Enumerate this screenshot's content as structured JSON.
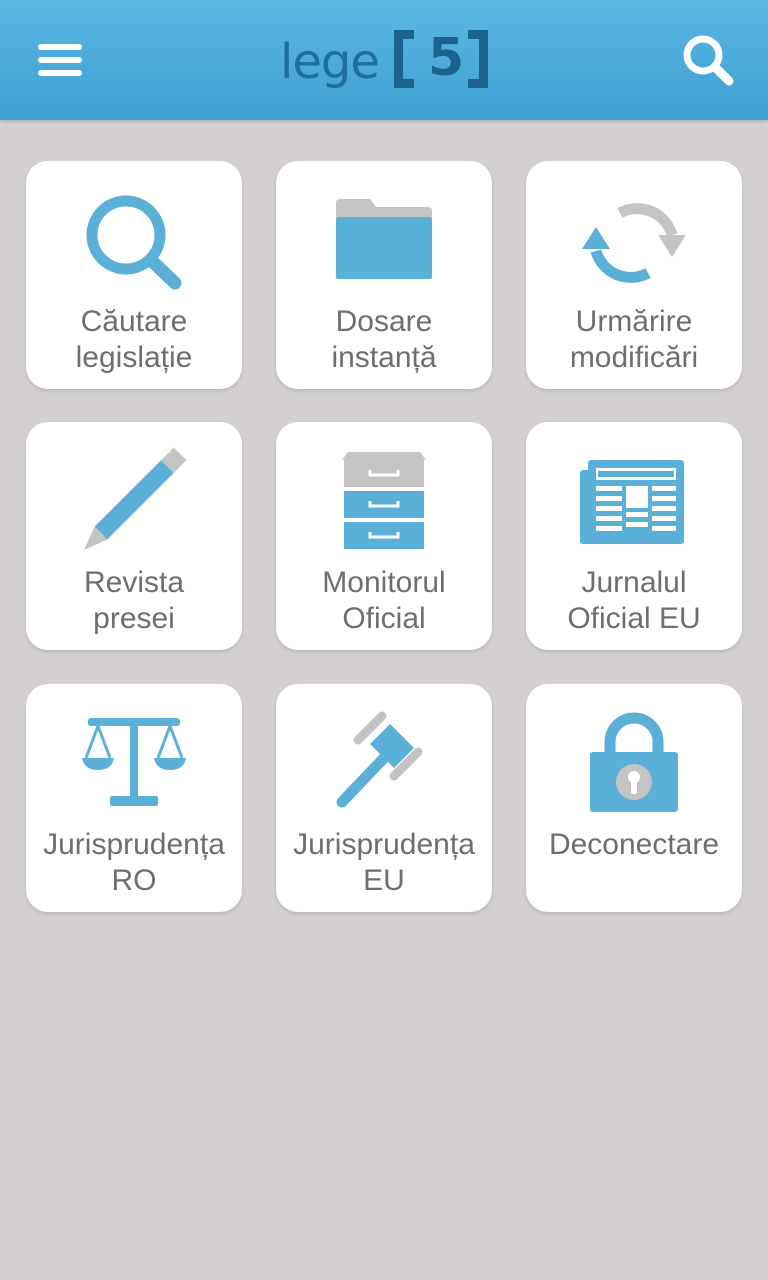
{
  "header": {
    "logo_text": "lege",
    "logo_number": "5",
    "menu_icon": "hamburger-menu-icon",
    "search_icon": "search-icon"
  },
  "tiles": [
    {
      "line1": "Căutare",
      "line2": "legislație",
      "icon": "search-icon"
    },
    {
      "line1": "Dosare",
      "line2": "instanță",
      "icon": "folder-icon"
    },
    {
      "line1": "Urmărire",
      "line2": "modificări",
      "icon": "sync-icon"
    },
    {
      "line1": "Revista",
      "line2": "presei",
      "icon": "pencil-icon"
    },
    {
      "line1": "Monitorul",
      "line2": "Oficial",
      "icon": "filing-cabinet-icon"
    },
    {
      "line1": "Jurnalul",
      "line2": "Oficial EU",
      "icon": "newspaper-icon"
    },
    {
      "line1": "Jurisprudența",
      "line2": "RO",
      "icon": "scales-icon"
    },
    {
      "line1": "Jurisprudența",
      "line2": "EU",
      "icon": "gavel-icon"
    },
    {
      "line1": "Deconectare",
      "line2": "",
      "icon": "padlock-icon"
    }
  ],
  "colors": {
    "header_top": "#5ab8e3",
    "header_bottom": "#3f9fd3",
    "icon_blue": "#5bb0d8",
    "icon_gray": "#c4c4c4",
    "label": "#6e6e6e",
    "background": "#d3d0cf"
  }
}
